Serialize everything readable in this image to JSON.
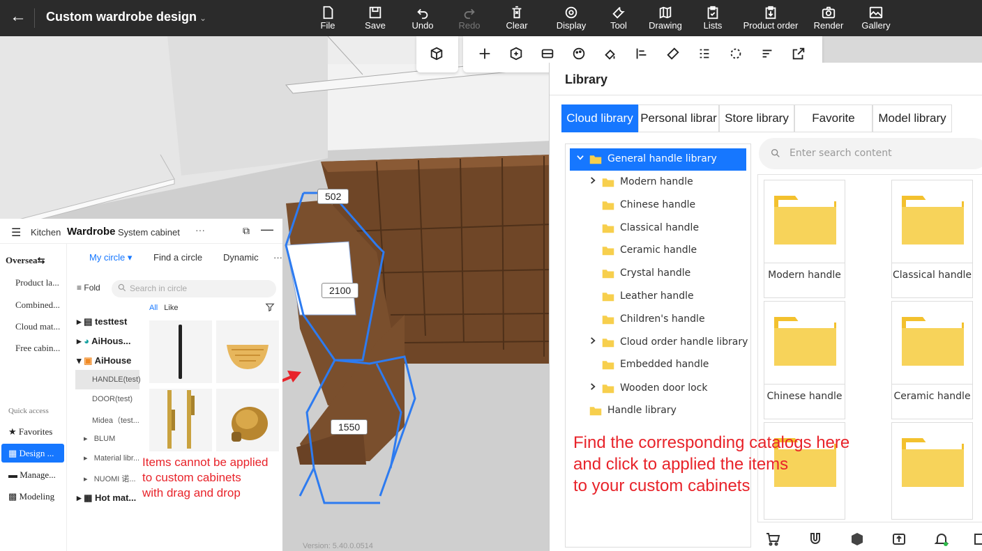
{
  "app": {
    "title": "Custom wardrobe design",
    "back_icon": "back-arrow-icon"
  },
  "toolbar": [
    {
      "label": "File",
      "icon": "file-icon",
      "enabled": true
    },
    {
      "label": "Save",
      "icon": "save-icon",
      "enabled": true
    },
    {
      "label": "Undo",
      "icon": "undo-icon",
      "enabled": true
    },
    {
      "label": "Redo",
      "icon": "redo-icon",
      "enabled": false
    },
    {
      "label": "Clear",
      "icon": "clear-icon",
      "enabled": true
    },
    {
      "label": "Display",
      "icon": "eye-icon",
      "enabled": true
    },
    {
      "label": "Tool",
      "icon": "wrench-icon",
      "enabled": true
    },
    {
      "label": "Drawing",
      "icon": "map-icon",
      "enabled": true
    },
    {
      "label": "Lists",
      "icon": "clipboard-icon",
      "enabled": true
    },
    {
      "label": "Product order",
      "icon": "order-icon",
      "enabled": true
    },
    {
      "label": "Render",
      "icon": "camera-icon",
      "enabled": true
    },
    {
      "label": "Gallery",
      "icon": "image-icon",
      "enabled": true
    }
  ],
  "viewport": {
    "dimensions": [
      "502",
      "2100",
      "1550"
    ],
    "version": "Version: 5.40.0.0514"
  },
  "left_panel": {
    "header": {
      "tab_kitchen": "Kitchen",
      "tab_wardrobe": "Wardrobe",
      "tab_system": "System cabinet"
    },
    "sidebar": {
      "region": "Oversea⇆",
      "items": [
        "Product la...",
        "Combined...",
        "Cloud mat...",
        "Free cabin..."
      ],
      "quick_access_label": "Quick access",
      "quick": [
        "Favorites",
        "Design ...",
        "Manage...",
        "Modeling"
      ]
    },
    "tabs": [
      "My circle ▾",
      "Find a circle",
      "Dynamic"
    ],
    "fold_label": "Fold",
    "search_placeholder": "Search in  circle",
    "tree": {
      "testtest": "testtest",
      "aihouse1": "AiHous...",
      "aihouse2": "AiHouse",
      "children": [
        "HANDLE(test)",
        "DOOR(test)",
        "Midea（test..."
      ],
      "blum": "BLUM",
      "material": "Material libr...",
      "nuomi": "NUOMI 诺...",
      "hot": "Hot mat..."
    },
    "filter_tabs": [
      "All",
      "Like"
    ]
  },
  "annotations": {
    "left": [
      "Items cannot be applied",
      "to custom cabinets",
      "with drag and drop"
    ],
    "right": [
      "Find the corresponding catalogs here",
      "and click to applied the items",
      "to your custom cabinets"
    ]
  },
  "library": {
    "title": "Library",
    "tabs": [
      "Cloud library",
      "Personal librar",
      "Store library",
      "Favorite",
      "Model library"
    ],
    "active_tab": "Cloud library",
    "search_placeholder": "Enter search content",
    "categories": {
      "root": "General handle library",
      "children": [
        "Modern handle",
        "Chinese handle",
        "Classical handle",
        "Ceramic handle",
        "Crystal handle",
        "Leather handle",
        "Children's handle",
        "Cloud order handle library",
        "Embedded handle",
        "Wooden door lock"
      ],
      "root2": "Handle library"
    },
    "cards": [
      "Modern handle",
      "Classical handle",
      "Chinese handle",
      "Ceramic handle"
    ]
  },
  "colors": {
    "accent": "#1677ff",
    "topbar": "#2b2b2b",
    "annotation": "#e8232a",
    "wood": "#7a4f2d",
    "folder": "#f7cf4d"
  }
}
